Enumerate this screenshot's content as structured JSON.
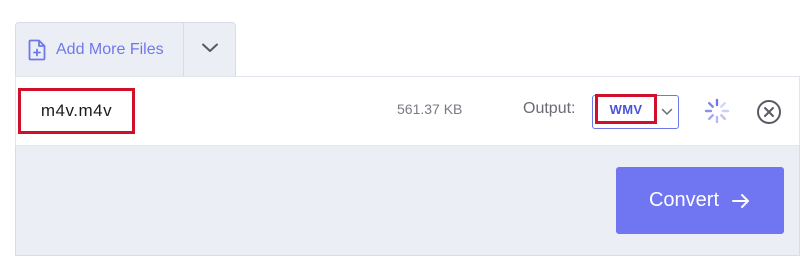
{
  "toolbar": {
    "add_files_label": "Add More Files",
    "add_icon": "file-plus-icon",
    "dropdown_icon": "chevron-down-icon"
  },
  "file": {
    "name": "m4v.m4v",
    "size": "561.37 KB",
    "output_label": "Output:",
    "output_format": "WMV",
    "status_icon": "loading-spinner-icon",
    "remove_icon": "close-circle-icon"
  },
  "actions": {
    "convert_label": "Convert",
    "convert_icon": "arrow-right-icon"
  },
  "colors": {
    "accent": "#7075f2",
    "link": "#6f78e8",
    "highlight": "#d0102a",
    "panel": "#eceef6"
  }
}
